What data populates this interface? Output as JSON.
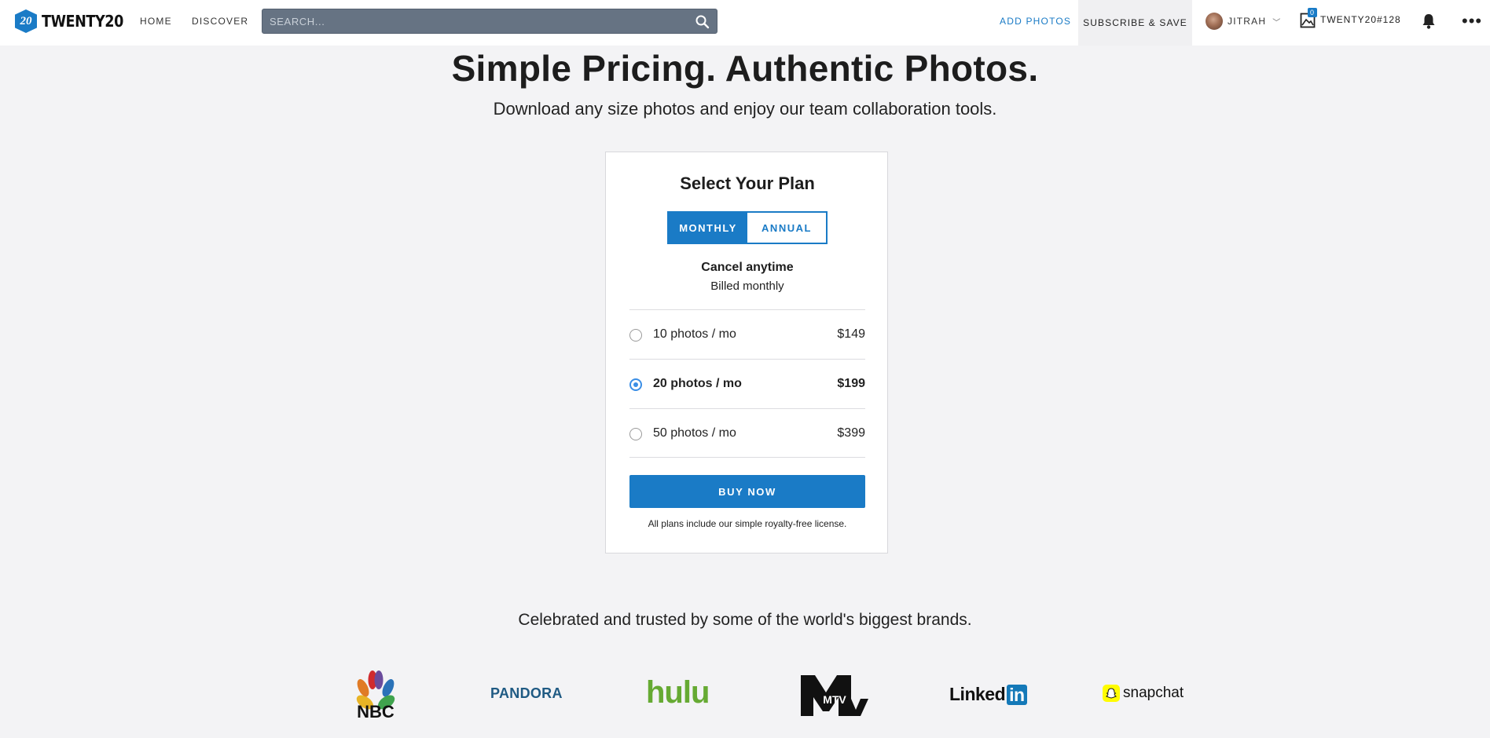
{
  "nav": {
    "logo_badge": "20",
    "logo_text": "TWENTY20",
    "links": [
      {
        "label": "HOME"
      },
      {
        "label": "DISCOVER"
      }
    ],
    "search_placeholder": "SEARCH...",
    "add_photos": "ADD PHOTOS",
    "subscribe": "SUBSCRIBE & SAVE",
    "user": "JITRAH",
    "lightbox_count": "0",
    "lightbox_label": "TWENTY20#128",
    "more": "•••"
  },
  "hero": {
    "title": "Simple Pricing. Authentic Photos.",
    "subtitle": "Download any size photos and enjoy our team collaboration tools."
  },
  "plan_card": {
    "title": "Select Your Plan",
    "toggle": {
      "monthly": "MONTHLY",
      "annual": "ANNUAL",
      "selected": "monthly"
    },
    "cancel": "Cancel anytime",
    "billed": "Billed monthly",
    "plans": [
      {
        "label": "10 photos / mo",
        "price": "$149",
        "selected": false
      },
      {
        "label": "20 photos / mo",
        "price": "$199",
        "selected": true
      },
      {
        "label": "50 photos / mo",
        "price": "$399",
        "selected": false
      }
    ],
    "buy": "BUY NOW",
    "license": "All plans include our simple royalty-free license."
  },
  "brands": {
    "title": "Celebrated and trusted by some of the world's biggest brands.",
    "logos": [
      {
        "name": "NBC",
        "text": "NBC"
      },
      {
        "name": "Pandora",
        "text": "PANDORA"
      },
      {
        "name": "Hulu",
        "text": "hulu"
      },
      {
        "name": "MTV",
        "text": "MTV"
      },
      {
        "name": "LinkedIn",
        "text": "Linked",
        "badge": "in"
      },
      {
        "name": "Snapchat",
        "text": "snapchat"
      }
    ]
  },
  "colors": {
    "accent": "#1a7bc6",
    "background": "#f3f3f5",
    "radio": "#3a8ee6"
  }
}
